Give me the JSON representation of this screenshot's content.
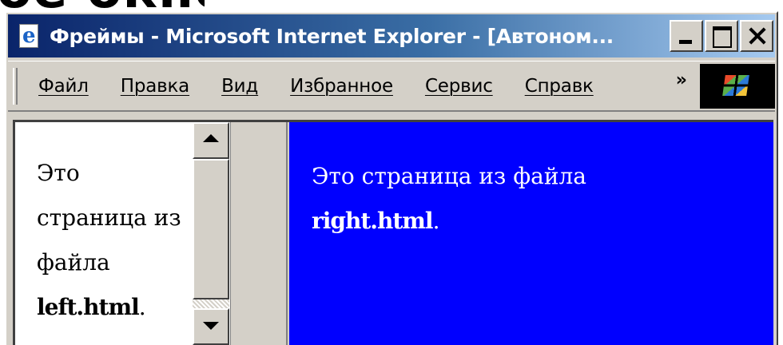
{
  "slide": {
    "heading_fragment": "ое окно"
  },
  "window": {
    "title": "Фреймы - Microsoft Internet Explorer - [Автоном...",
    "controls": {
      "minimize": "minimize",
      "maximize": "maximize",
      "close": "close"
    }
  },
  "menubar": {
    "items": [
      {
        "label": "Файл"
      },
      {
        "label": "Правка"
      },
      {
        "label": "Вид"
      },
      {
        "label": "Избранное"
      },
      {
        "label": "Сервис"
      },
      {
        "label": "Справк"
      }
    ],
    "overflow_chevron": "»"
  },
  "frames": {
    "left": {
      "text": "Это страница из файла",
      "filename": "left.html",
      "suffix": "."
    },
    "right": {
      "text": "Это страница из файла",
      "filename": "right.html",
      "suffix": ".",
      "background": "#0000ff"
    }
  },
  "colors": {
    "titlebar_start": "#0a246a",
    "titlebar_end": "#a6caf0",
    "chrome": "#d4d0c8"
  }
}
